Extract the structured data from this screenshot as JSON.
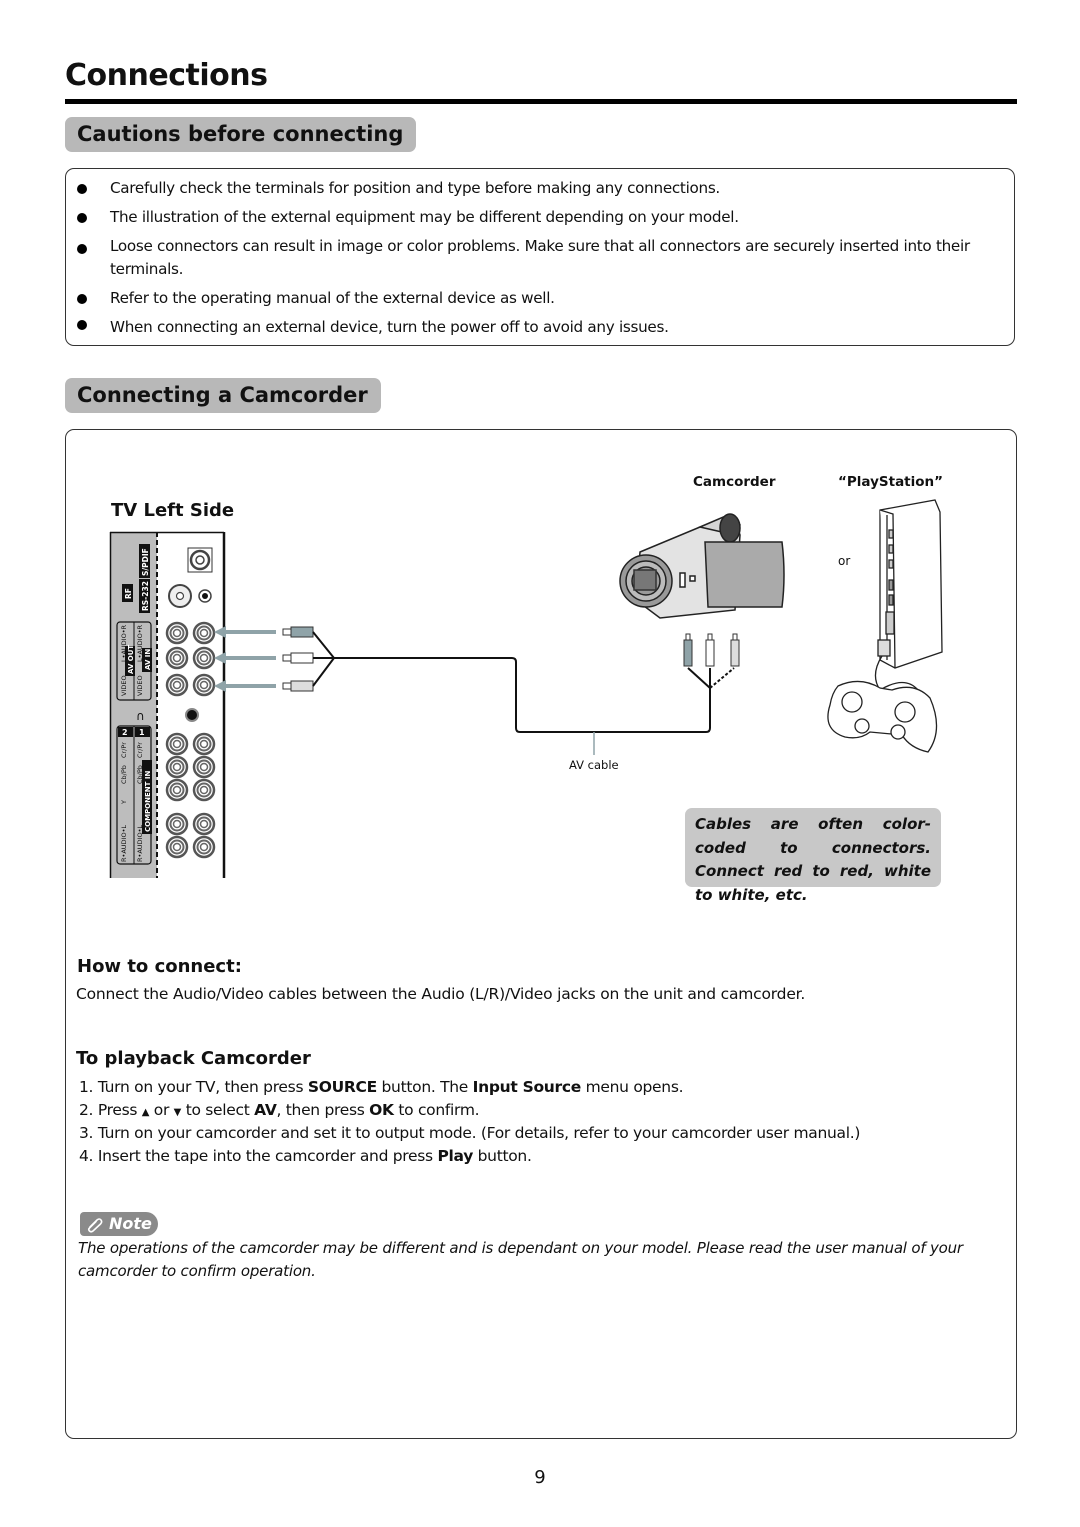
{
  "page": {
    "title": "Connections",
    "number": "9"
  },
  "cautions": {
    "heading": "Cautions before connecting",
    "items": [
      "Carefully check the terminals for position and type before making any connections.",
      "The illustration of the external equipment may be different depending on your model.",
      "Loose connectors can result in image or color problems. Make sure that all connectors are securely inserted into their terminals.",
      "Refer to the operating manual of the external device as well.",
      "When connecting an external device, turn the power off to avoid any issues."
    ]
  },
  "camcorder_section": {
    "heading": "Connecting a Camcorder",
    "diagram": {
      "tv_label": "TV Left Side",
      "panel_labels": {
        "spdif": "S/PDIF",
        "rf": "RF",
        "rs232": "RS-232",
        "av_out": "AV OUT",
        "av_in": "AV IN",
        "audio_lr": "L•AUDIO•R",
        "video": "VIDEO",
        "component_in": "COMPONENT IN",
        "y": "Y",
        "cb": "Cb/Pb",
        "cr": "Cr/Pr",
        "audio_rl": "R•AUDIO•L",
        "comp1": "1",
        "comp2": "2"
      },
      "camcorder_label": "Camcorder",
      "playstation_label": "“PlayStation”",
      "or_label": "or",
      "cable_label": "AV cable",
      "icons": [
        "tv-side-panel-icon",
        "rca-plug-icon",
        "camcorder-icon",
        "playstation-console-icon",
        "gamepad-icon",
        "headphone-icon"
      ]
    },
    "tip": "Cables are often color-coded to connectors. Connect red to red, white to white, etc.",
    "how_to": {
      "heading": "How to connect:",
      "text": "Connect the Audio/Video cables between the Audio (L/R)/Video jacks on the unit and camcorder."
    },
    "playback": {
      "heading": "To playback Camcorder",
      "steps": [
        {
          "n": "1.",
          "a": "Turn on your TV,  then press ",
          "b1": "SOURCE",
          "c": " button. The ",
          "b2": "Input Source",
          "d": " menu opens."
        },
        {
          "n": "2.",
          "a": "Press ",
          "up": "▲",
          "or": " or ",
          "down": "▼",
          "c": " to select ",
          "b1": "AV",
          "d": ", then press ",
          "b2": "OK",
          "e": " to confirm."
        },
        {
          "n": "3.",
          "a": "Turn on your camcorder and set it to output mode. (For details, refer to your camcorder user manual.)"
        },
        {
          "n": "4.",
          "a": "Insert the tape into the camcorder and press ",
          "b1": "Play",
          "c": " button."
        }
      ]
    },
    "note": {
      "label": "Note",
      "icon": "paperclip-icon",
      "text": "The operations of the camcorder may be different and is dependant on your model. Please read the user manual of your camcorder to confirm operation."
    }
  }
}
